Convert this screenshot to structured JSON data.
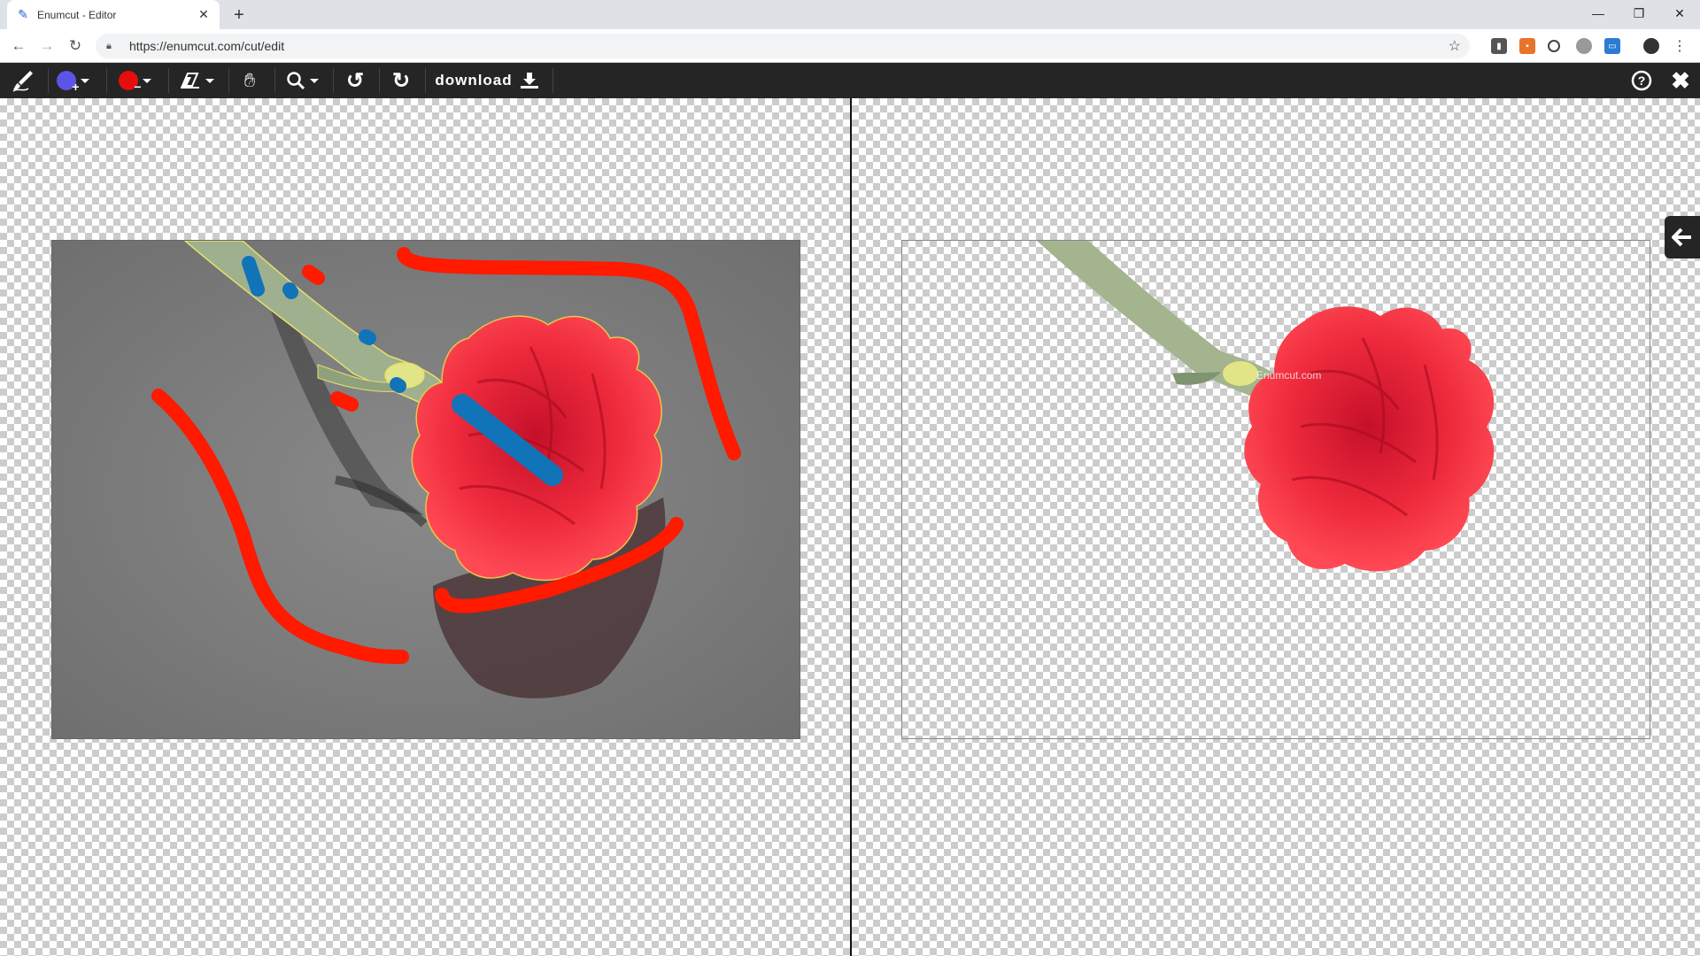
{
  "browser": {
    "tab_title": "Enumcut - Editor",
    "url": "https://enumcut.com/cut/edit"
  },
  "toolbar": {
    "download_label": "download",
    "foreground_color": "#5b55e6",
    "background_color": "#e60d0d",
    "icons": [
      "brush-logo-icon",
      "add-foreground-icon",
      "add-background-icon",
      "eraser-icon",
      "hand-pan-icon",
      "zoom-icon",
      "undo-icon",
      "redo-icon",
      "download-icon",
      "help-icon",
      "close-icon"
    ]
  },
  "canvas": {
    "watermark": "Enumcut.com",
    "stroke_colors": {
      "keep": "#1173b8",
      "remove": "#ff1a00",
      "outline": "#f2e64d"
    }
  }
}
